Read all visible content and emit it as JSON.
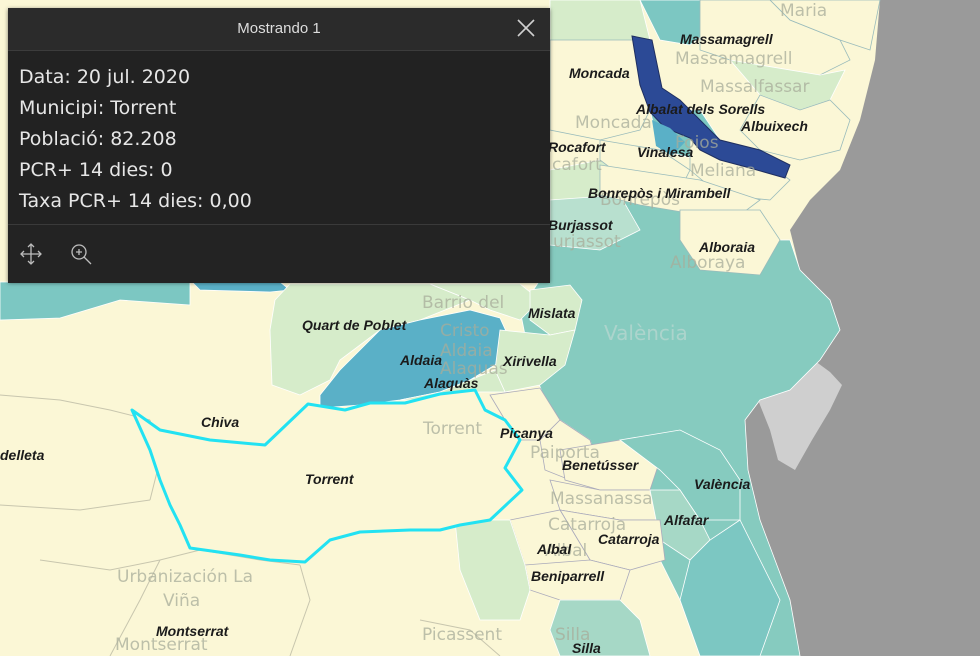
{
  "popup": {
    "title": "Mostrando 1",
    "fields": [
      {
        "label": "Data:",
        "value": "20 jul. 2020"
      },
      {
        "label": "Municipi:",
        "value": "Torrent"
      },
      {
        "label": "Població:",
        "value": "82.208"
      },
      {
        "label": "PCR+ 14 dies:",
        "value": "0"
      },
      {
        "label": "Taxa PCR+ 14 dies:",
        "value": "0,00"
      }
    ],
    "actions": [
      {
        "name": "move-icon"
      },
      {
        "name": "zoom-in-icon"
      }
    ],
    "close_icon": "close-icon"
  },
  "map": {
    "colors": {
      "lightest": "#fbf7d6",
      "light": "#d6ecca",
      "medium": "#a6d8c6",
      "teal": "#7cc7c2",
      "blue": "#5ab0c7",
      "dark": "#2c4a96",
      "sea": "#9a9a9a",
      "highlight": "#22e2f2"
    },
    "labels": {
      "massamagrell": "Massamagrell",
      "moncada": "Moncada",
      "albalat": "Albalat dels Sorells",
      "albuixech": "Albuixech",
      "vinalesa": "Vinalesa",
      "rocafort": "Rocafort",
      "bonrepos": "Bonrepòs i Mirambell",
      "burjassot": "Burjassot",
      "alboraia": "Alboraia",
      "quart": "Quart de Poblet",
      "mislata": "Mislata",
      "aldaia": "Aldaia",
      "xirivella": "Xirivella",
      "alaquas": "Alaquàs",
      "chiva": "Chiva",
      "picanya": "Picanya",
      "benetusser": "Benetússer",
      "valencia": "València",
      "torrent": "Torrent",
      "cheste": "delleta",
      "alfafar": "Alfafar",
      "catarroja": "Catarroja",
      "albal": "Albal",
      "beniparrell": "Beniparrell",
      "montserrat": "Montserrat",
      "silla": "Silla"
    },
    "basemap": {
      "maria": "Maria",
      "massamagrell_bg": "Massamagrell",
      "massalfassar": "Massalfassar",
      "moncada_bg": "Moncada",
      "foios": "Foios",
      "meliana": "Meliana",
      "rocafort_bg": "cafort",
      "bonrepos_bg": "Bonrepòs",
      "burjassot_bg": "urjassot",
      "alboraya": "Alboraya",
      "barrio": "Barrio del",
      "cristo": "Cristo",
      "aldaia_bg": "Aldaia",
      "alaquas_bg": "Alaquas",
      "valencia_bg": "València",
      "torrent_bg": "Torrent",
      "paiporta": "Paiporta",
      "massanassa": "Massanassa",
      "catarroja_bg": "Catarroja",
      "albal_bg": "Albal",
      "urbanizacion": "Urbanización La",
      "vina": "Viña",
      "montserrat_bg": "Montserrat",
      "picassent": "Picassent",
      "silla_bg": "Silla"
    }
  }
}
